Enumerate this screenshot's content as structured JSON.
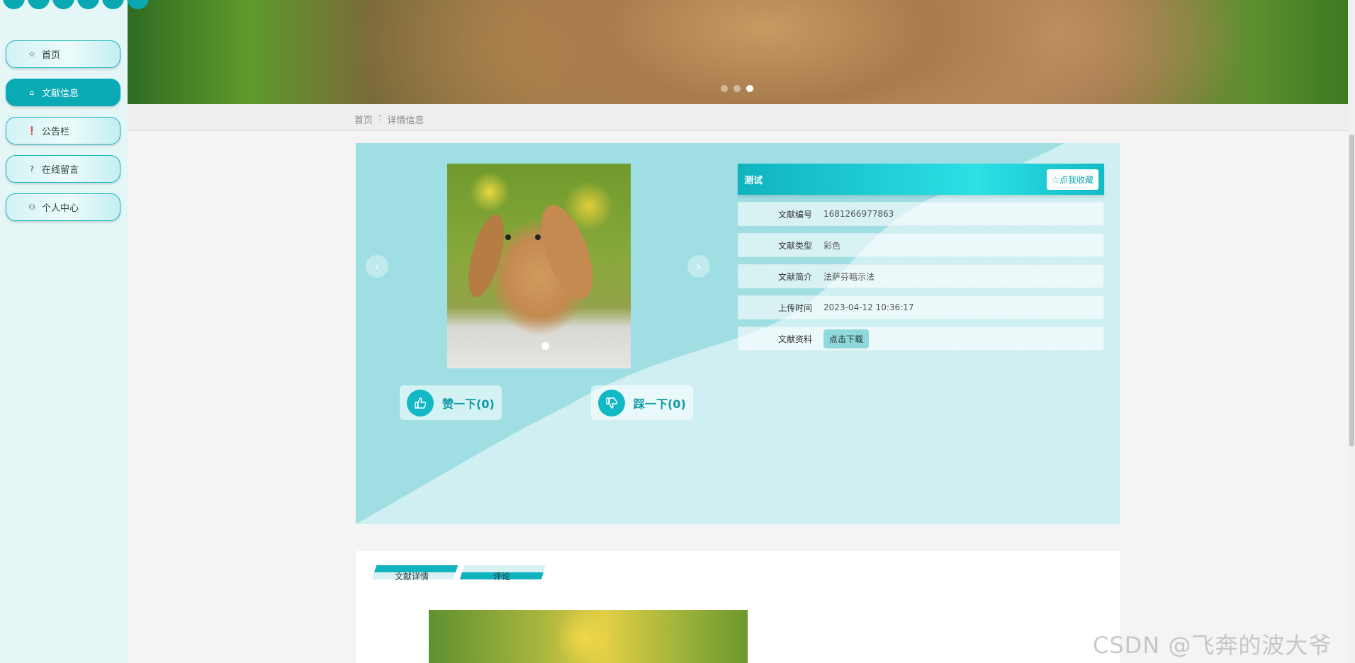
{
  "sidebar": {
    "items": [
      {
        "label": "首页",
        "icon": "star-outline-icon",
        "glyph": "☆",
        "active": false
      },
      {
        "label": "文献信息",
        "icon": "bag-icon",
        "glyph": "⌂",
        "active": true
      },
      {
        "label": "公告栏",
        "icon": "exclamation-circle-icon",
        "glyph": "❗",
        "active": false
      },
      {
        "label": "在线留言",
        "icon": "question-circle-icon",
        "glyph": "?",
        "active": false
      },
      {
        "label": "个人中心",
        "icon": "user-icon",
        "glyph": "⚇",
        "active": false
      }
    ]
  },
  "banner": {
    "slides_total": 3,
    "active_slide": 3
  },
  "breadcrumb": {
    "home": "首页",
    "separator": ":",
    "current": "详情信息"
  },
  "detail": {
    "title": "测试",
    "favorite_label": "☆点我收藏",
    "fields": [
      {
        "key": "文献编号",
        "value": "1681266977863"
      },
      {
        "key": "文献类型",
        "value": "彩色"
      },
      {
        "key": "文献简介",
        "value": "法萨芬暗示法"
      },
      {
        "key": "上传时间",
        "value": "2023-04-12 10:36:17"
      }
    ],
    "download_key": "文献资料",
    "download_label": "点击下载",
    "like_label": "赞一下(0)",
    "dislike_label": "踩一下(0)",
    "prev_arrow": "‹",
    "next_arrow": "›"
  },
  "tabs": [
    {
      "label": "文献详情"
    },
    {
      "label": "评论"
    }
  ],
  "watermark": "CSDN @飞奔的波大爷",
  "colors": {
    "accent": "#0aaab5",
    "panel_bg": "#cfeff2",
    "panel_wave": "#9fdfe4"
  }
}
